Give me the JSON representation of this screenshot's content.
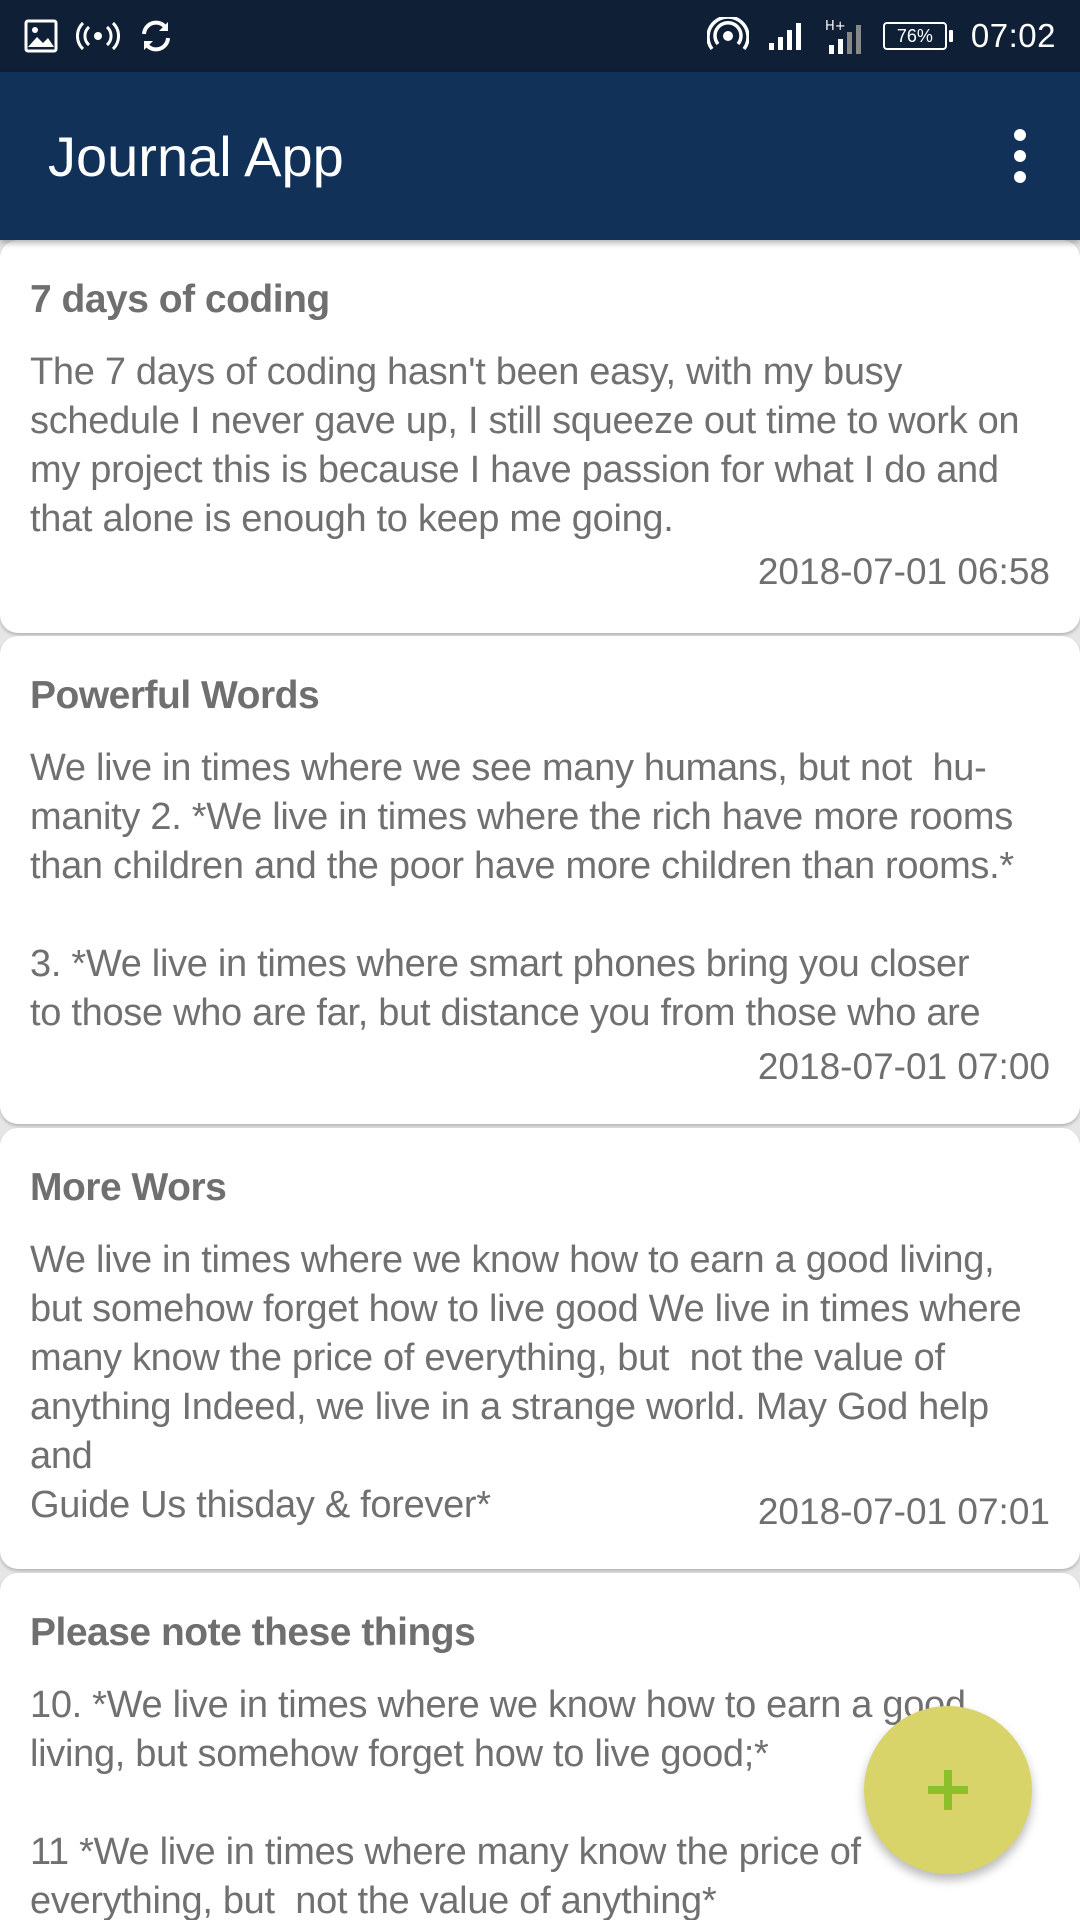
{
  "status_bar": {
    "icons_left": [
      "image-icon",
      "hotspot-icon",
      "sync-icon"
    ],
    "icons_right": [
      "wifi-icon",
      "signal-icon",
      "signal-secondary-icon"
    ],
    "battery": "76%",
    "battery_level": 0.76,
    "time": "07:02"
  },
  "app_bar": {
    "title": "Journal App",
    "menu_icon": "more-vert-icon"
  },
  "entries": [
    {
      "title": "7 days of coding",
      "body": "The 7 days of coding hasn't been easy, with my busy\nschedule I never gave up, I still squeeze out time to work on\nmy project this is because I have passion for what I do and\nthat alone is enough to keep me going.",
      "date": "2018-07-01 06:58"
    },
    {
      "title": "Powerful Words",
      "body": "We live in times where we see many humans, but not  hu-\nmanity 2. *We live in times where the rich have more rooms\nthan children and the poor have more children than rooms.*\n\n3. *We live in times where smart phones bring you closer\nto those who are far, but distance you from those who are",
      "date": "2018-07-01 07:00"
    },
    {
      "title": "More Wors",
      "body": "We live in times where we know how to earn a good living,\nbut somehow forget how to live good We live in times where\nmany know the price of everything, but  not the value of\nanything Indeed, we live in a strange world. May God help and\nGuide Us thisday & forever*",
      "date": "2018-07-01 07:01"
    },
    {
      "title": "Please note these things",
      "body": "10. *We live in times where we know how to earn a good\nliving, but somehow forget how to live good;*\n\n11 *We live in times where many know the price of\neverything, but  not the value of anything*",
      "date": ""
    }
  ],
  "fab": {
    "icon": "add-icon",
    "color": "#d8d46a",
    "icon_color": "#8cbf2a"
  },
  "colors": {
    "status_bar": "#0e1f36",
    "app_bar": "#123158",
    "background": "#e6e6e6",
    "card": "#ffffff",
    "text": "#707070"
  }
}
